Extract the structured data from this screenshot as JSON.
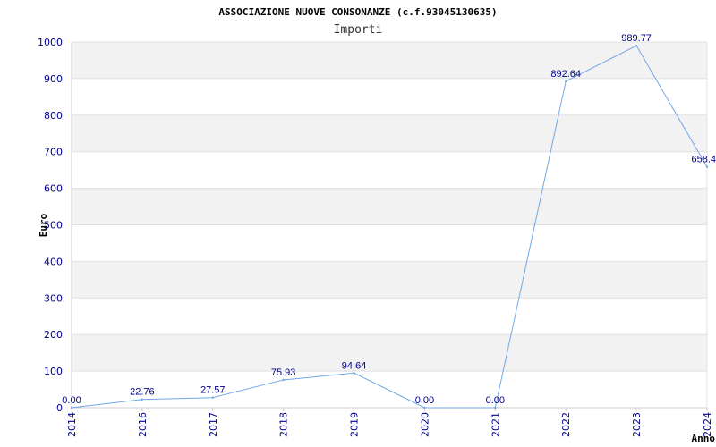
{
  "title": "ASSOCIAZIONE NUOVE CONSONANZE (c.f.93045130635)",
  "subtitle": "Importi",
  "chart_data": {
    "type": "line",
    "title": "ASSOCIAZIONE NUOVE CONSONANZE (c.f.93045130635)",
    "subtitle": "Importi",
    "xlabel": "Anno",
    "ylabel": "Euro",
    "categories": [
      "2014",
      "2016",
      "2017",
      "2018",
      "2019",
      "2020",
      "2021",
      "2022",
      "2023",
      "2024"
    ],
    "series": [
      {
        "values": [
          0.0,
          22.76,
          27.57,
          75.93,
          94.64,
          0.0,
          0.0,
          892.64,
          989.77,
          658.4
        ],
        "labels": [
          "0.00",
          "22.76",
          "27.57",
          "75.93",
          "94.64",
          "0.00",
          "0.00",
          "892.64",
          "989.77",
          "658.4"
        ],
        "color": "#6fa8e8"
      }
    ],
    "ylim": [
      0,
      1000
    ],
    "yticks": [
      0,
      100,
      200,
      300,
      400,
      500,
      600,
      700,
      800,
      900,
      1000
    ],
    "grid": true,
    "band_colors": [
      "#f2f2f2",
      "#ffffff"
    ],
    "axis_color": "#cccccc",
    "tick_color": "#00008b"
  }
}
